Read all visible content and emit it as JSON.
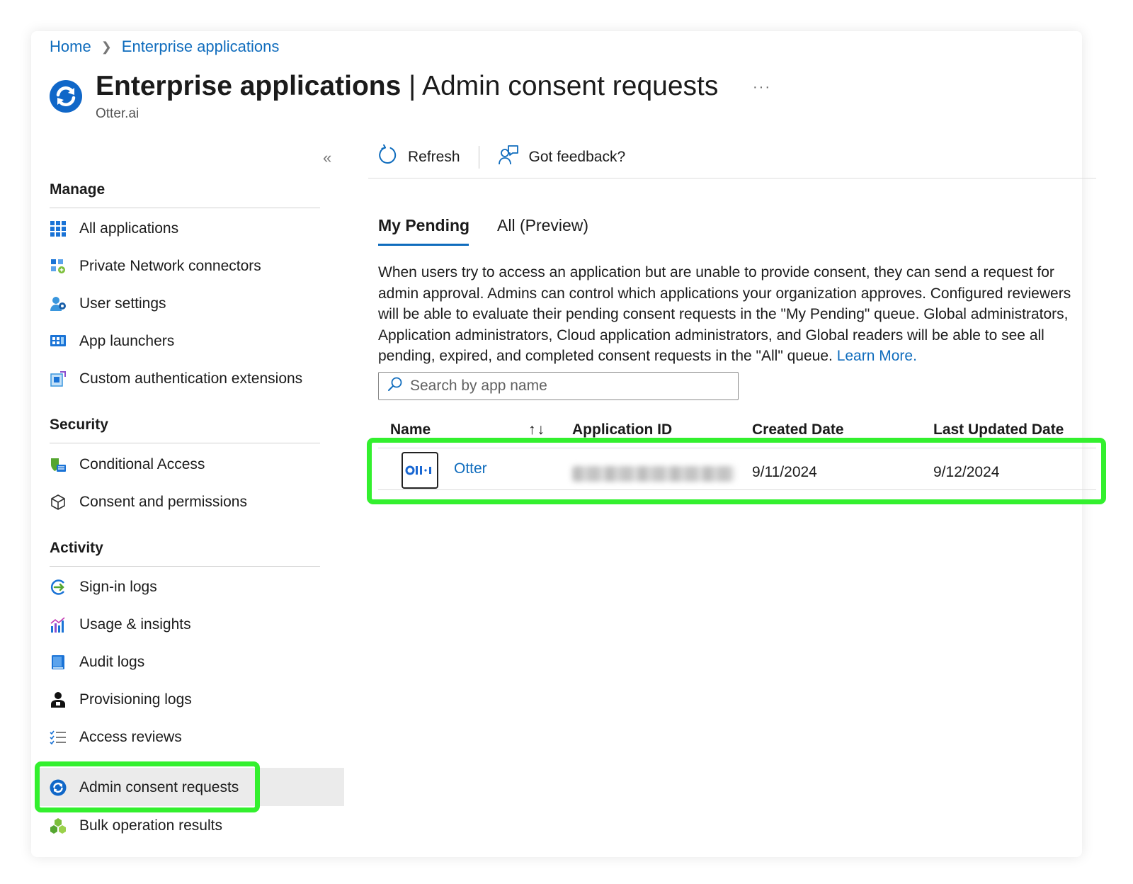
{
  "breadcrumb": {
    "home": "Home",
    "current": "Enterprise applications"
  },
  "header": {
    "title_main": "Enterprise applications",
    "title_sep": " | ",
    "title_sub": "Admin consent requests",
    "subtitle": "Otter.ai",
    "more": "···"
  },
  "sidebar": {
    "collapse": "«",
    "sections": {
      "manage": "Manage",
      "security": "Security",
      "activity": "Activity"
    },
    "items": {
      "all_applications": "All applications",
      "private_network_connectors": "Private Network connectors",
      "user_settings": "User settings",
      "app_launchers": "App launchers",
      "custom_auth_extensions": "Custom authentication extensions",
      "conditional_access": "Conditional Access",
      "consent_permissions": "Consent and permissions",
      "signin_logs": "Sign-in logs",
      "usage_insights": "Usage & insights",
      "audit_logs": "Audit logs",
      "provisioning_logs": "Provisioning logs",
      "access_reviews": "Access reviews",
      "admin_consent_requests": "Admin consent requests",
      "bulk_operation_results": "Bulk operation results"
    }
  },
  "toolbar": {
    "refresh": "Refresh",
    "feedback": "Got feedback?"
  },
  "tabs": {
    "my_pending": "My Pending",
    "all": "All (Preview)"
  },
  "description": {
    "text": "When users try to access an application but are unable to provide consent, they can send a request for admin approval. Admins can control which applications your organization approves. Configured reviewers will be able to evaluate their pending consent requests in the \"My Pending\" queue. Global administrators, Application administrators, Cloud application administrators, and Global readers will be able to see all pending, expired, and completed consent requests in the \"All\" queue.",
    "link": "Learn More."
  },
  "search": {
    "placeholder": "Search by app name",
    "value": ""
  },
  "table": {
    "columns": {
      "name": "Name",
      "sort": "↑↓",
      "app_id": "Application ID",
      "created": "Created Date",
      "updated": "Last Updated Date"
    },
    "rows": [
      {
        "name": "Otter",
        "logo_text": "OII•I",
        "created": "9/11/2024",
        "updated": "9/12/2024"
      }
    ]
  },
  "colors": {
    "accent": "#0f6cbd",
    "highlight": "#33f02e",
    "selected_bg": "#ebebeb"
  }
}
